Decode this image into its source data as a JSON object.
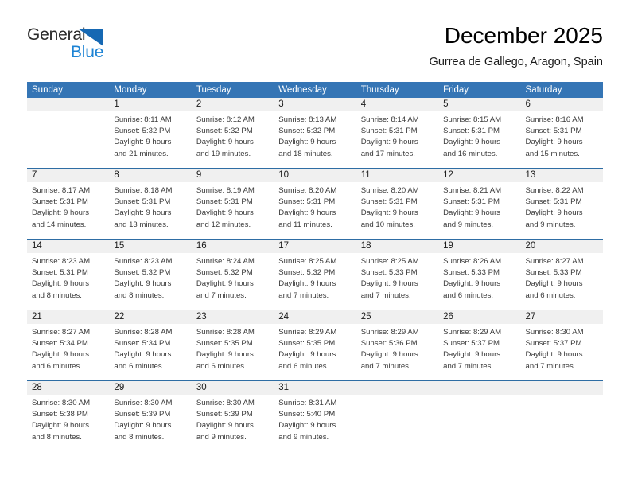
{
  "brand": {
    "name_top": "General",
    "name_bottom": "Blue",
    "accent_color": "#1c83d4",
    "triangle_color": "#1668b3"
  },
  "header": {
    "title": "December 2025",
    "subtitle": "Gurrea de Gallego, Aragon, Spain"
  },
  "theme": {
    "header_blue": "#3575b5",
    "separator_blue": "#2e6da4",
    "day_band_gray": "#f0f0f0"
  },
  "weekdays": [
    "Sunday",
    "Monday",
    "Tuesday",
    "Wednesday",
    "Thursday",
    "Friday",
    "Saturday"
  ],
  "weeks": [
    [
      {
        "day": "",
        "lines": []
      },
      {
        "day": "1",
        "lines": [
          "Sunrise: 8:11 AM",
          "Sunset: 5:32 PM",
          "Daylight: 9 hours",
          "and 21 minutes."
        ]
      },
      {
        "day": "2",
        "lines": [
          "Sunrise: 8:12 AM",
          "Sunset: 5:32 PM",
          "Daylight: 9 hours",
          "and 19 minutes."
        ]
      },
      {
        "day": "3",
        "lines": [
          "Sunrise: 8:13 AM",
          "Sunset: 5:32 PM",
          "Daylight: 9 hours",
          "and 18 minutes."
        ]
      },
      {
        "day": "4",
        "lines": [
          "Sunrise: 8:14 AM",
          "Sunset: 5:31 PM",
          "Daylight: 9 hours",
          "and 17 minutes."
        ]
      },
      {
        "day": "5",
        "lines": [
          "Sunrise: 8:15 AM",
          "Sunset: 5:31 PM",
          "Daylight: 9 hours",
          "and 16 minutes."
        ]
      },
      {
        "day": "6",
        "lines": [
          "Sunrise: 8:16 AM",
          "Sunset: 5:31 PM",
          "Daylight: 9 hours",
          "and 15 minutes."
        ]
      }
    ],
    [
      {
        "day": "7",
        "lines": [
          "Sunrise: 8:17 AM",
          "Sunset: 5:31 PM",
          "Daylight: 9 hours",
          "and 14 minutes."
        ]
      },
      {
        "day": "8",
        "lines": [
          "Sunrise: 8:18 AM",
          "Sunset: 5:31 PM",
          "Daylight: 9 hours",
          "and 13 minutes."
        ]
      },
      {
        "day": "9",
        "lines": [
          "Sunrise: 8:19 AM",
          "Sunset: 5:31 PM",
          "Daylight: 9 hours",
          "and 12 minutes."
        ]
      },
      {
        "day": "10",
        "lines": [
          "Sunrise: 8:20 AM",
          "Sunset: 5:31 PM",
          "Daylight: 9 hours",
          "and 11 minutes."
        ]
      },
      {
        "day": "11",
        "lines": [
          "Sunrise: 8:20 AM",
          "Sunset: 5:31 PM",
          "Daylight: 9 hours",
          "and 10 minutes."
        ]
      },
      {
        "day": "12",
        "lines": [
          "Sunrise: 8:21 AM",
          "Sunset: 5:31 PM",
          "Daylight: 9 hours",
          "and 9 minutes."
        ]
      },
      {
        "day": "13",
        "lines": [
          "Sunrise: 8:22 AM",
          "Sunset: 5:31 PM",
          "Daylight: 9 hours",
          "and 9 minutes."
        ]
      }
    ],
    [
      {
        "day": "14",
        "lines": [
          "Sunrise: 8:23 AM",
          "Sunset: 5:31 PM",
          "Daylight: 9 hours",
          "and 8 minutes."
        ]
      },
      {
        "day": "15",
        "lines": [
          "Sunrise: 8:23 AM",
          "Sunset: 5:32 PM",
          "Daylight: 9 hours",
          "and 8 minutes."
        ]
      },
      {
        "day": "16",
        "lines": [
          "Sunrise: 8:24 AM",
          "Sunset: 5:32 PM",
          "Daylight: 9 hours",
          "and 7 minutes."
        ]
      },
      {
        "day": "17",
        "lines": [
          "Sunrise: 8:25 AM",
          "Sunset: 5:32 PM",
          "Daylight: 9 hours",
          "and 7 minutes."
        ]
      },
      {
        "day": "18",
        "lines": [
          "Sunrise: 8:25 AM",
          "Sunset: 5:33 PM",
          "Daylight: 9 hours",
          "and 7 minutes."
        ]
      },
      {
        "day": "19",
        "lines": [
          "Sunrise: 8:26 AM",
          "Sunset: 5:33 PM",
          "Daylight: 9 hours",
          "and 6 minutes."
        ]
      },
      {
        "day": "20",
        "lines": [
          "Sunrise: 8:27 AM",
          "Sunset: 5:33 PM",
          "Daylight: 9 hours",
          "and 6 minutes."
        ]
      }
    ],
    [
      {
        "day": "21",
        "lines": [
          "Sunrise: 8:27 AM",
          "Sunset: 5:34 PM",
          "Daylight: 9 hours",
          "and 6 minutes."
        ]
      },
      {
        "day": "22",
        "lines": [
          "Sunrise: 8:28 AM",
          "Sunset: 5:34 PM",
          "Daylight: 9 hours",
          "and 6 minutes."
        ]
      },
      {
        "day": "23",
        "lines": [
          "Sunrise: 8:28 AM",
          "Sunset: 5:35 PM",
          "Daylight: 9 hours",
          "and 6 minutes."
        ]
      },
      {
        "day": "24",
        "lines": [
          "Sunrise: 8:29 AM",
          "Sunset: 5:35 PM",
          "Daylight: 9 hours",
          "and 6 minutes."
        ]
      },
      {
        "day": "25",
        "lines": [
          "Sunrise: 8:29 AM",
          "Sunset: 5:36 PM",
          "Daylight: 9 hours",
          "and 7 minutes."
        ]
      },
      {
        "day": "26",
        "lines": [
          "Sunrise: 8:29 AM",
          "Sunset: 5:37 PM",
          "Daylight: 9 hours",
          "and 7 minutes."
        ]
      },
      {
        "day": "27",
        "lines": [
          "Sunrise: 8:30 AM",
          "Sunset: 5:37 PM",
          "Daylight: 9 hours",
          "and 7 minutes."
        ]
      }
    ],
    [
      {
        "day": "28",
        "lines": [
          "Sunrise: 8:30 AM",
          "Sunset: 5:38 PM",
          "Daylight: 9 hours",
          "and 8 minutes."
        ]
      },
      {
        "day": "29",
        "lines": [
          "Sunrise: 8:30 AM",
          "Sunset: 5:39 PM",
          "Daylight: 9 hours",
          "and 8 minutes."
        ]
      },
      {
        "day": "30",
        "lines": [
          "Sunrise: 8:30 AM",
          "Sunset: 5:39 PM",
          "Daylight: 9 hours",
          "and 9 minutes."
        ]
      },
      {
        "day": "31",
        "lines": [
          "Sunrise: 8:31 AM",
          "Sunset: 5:40 PM",
          "Daylight: 9 hours",
          "and 9 minutes."
        ]
      },
      {
        "day": "",
        "lines": []
      },
      {
        "day": "",
        "lines": []
      },
      {
        "day": "",
        "lines": []
      }
    ]
  ]
}
